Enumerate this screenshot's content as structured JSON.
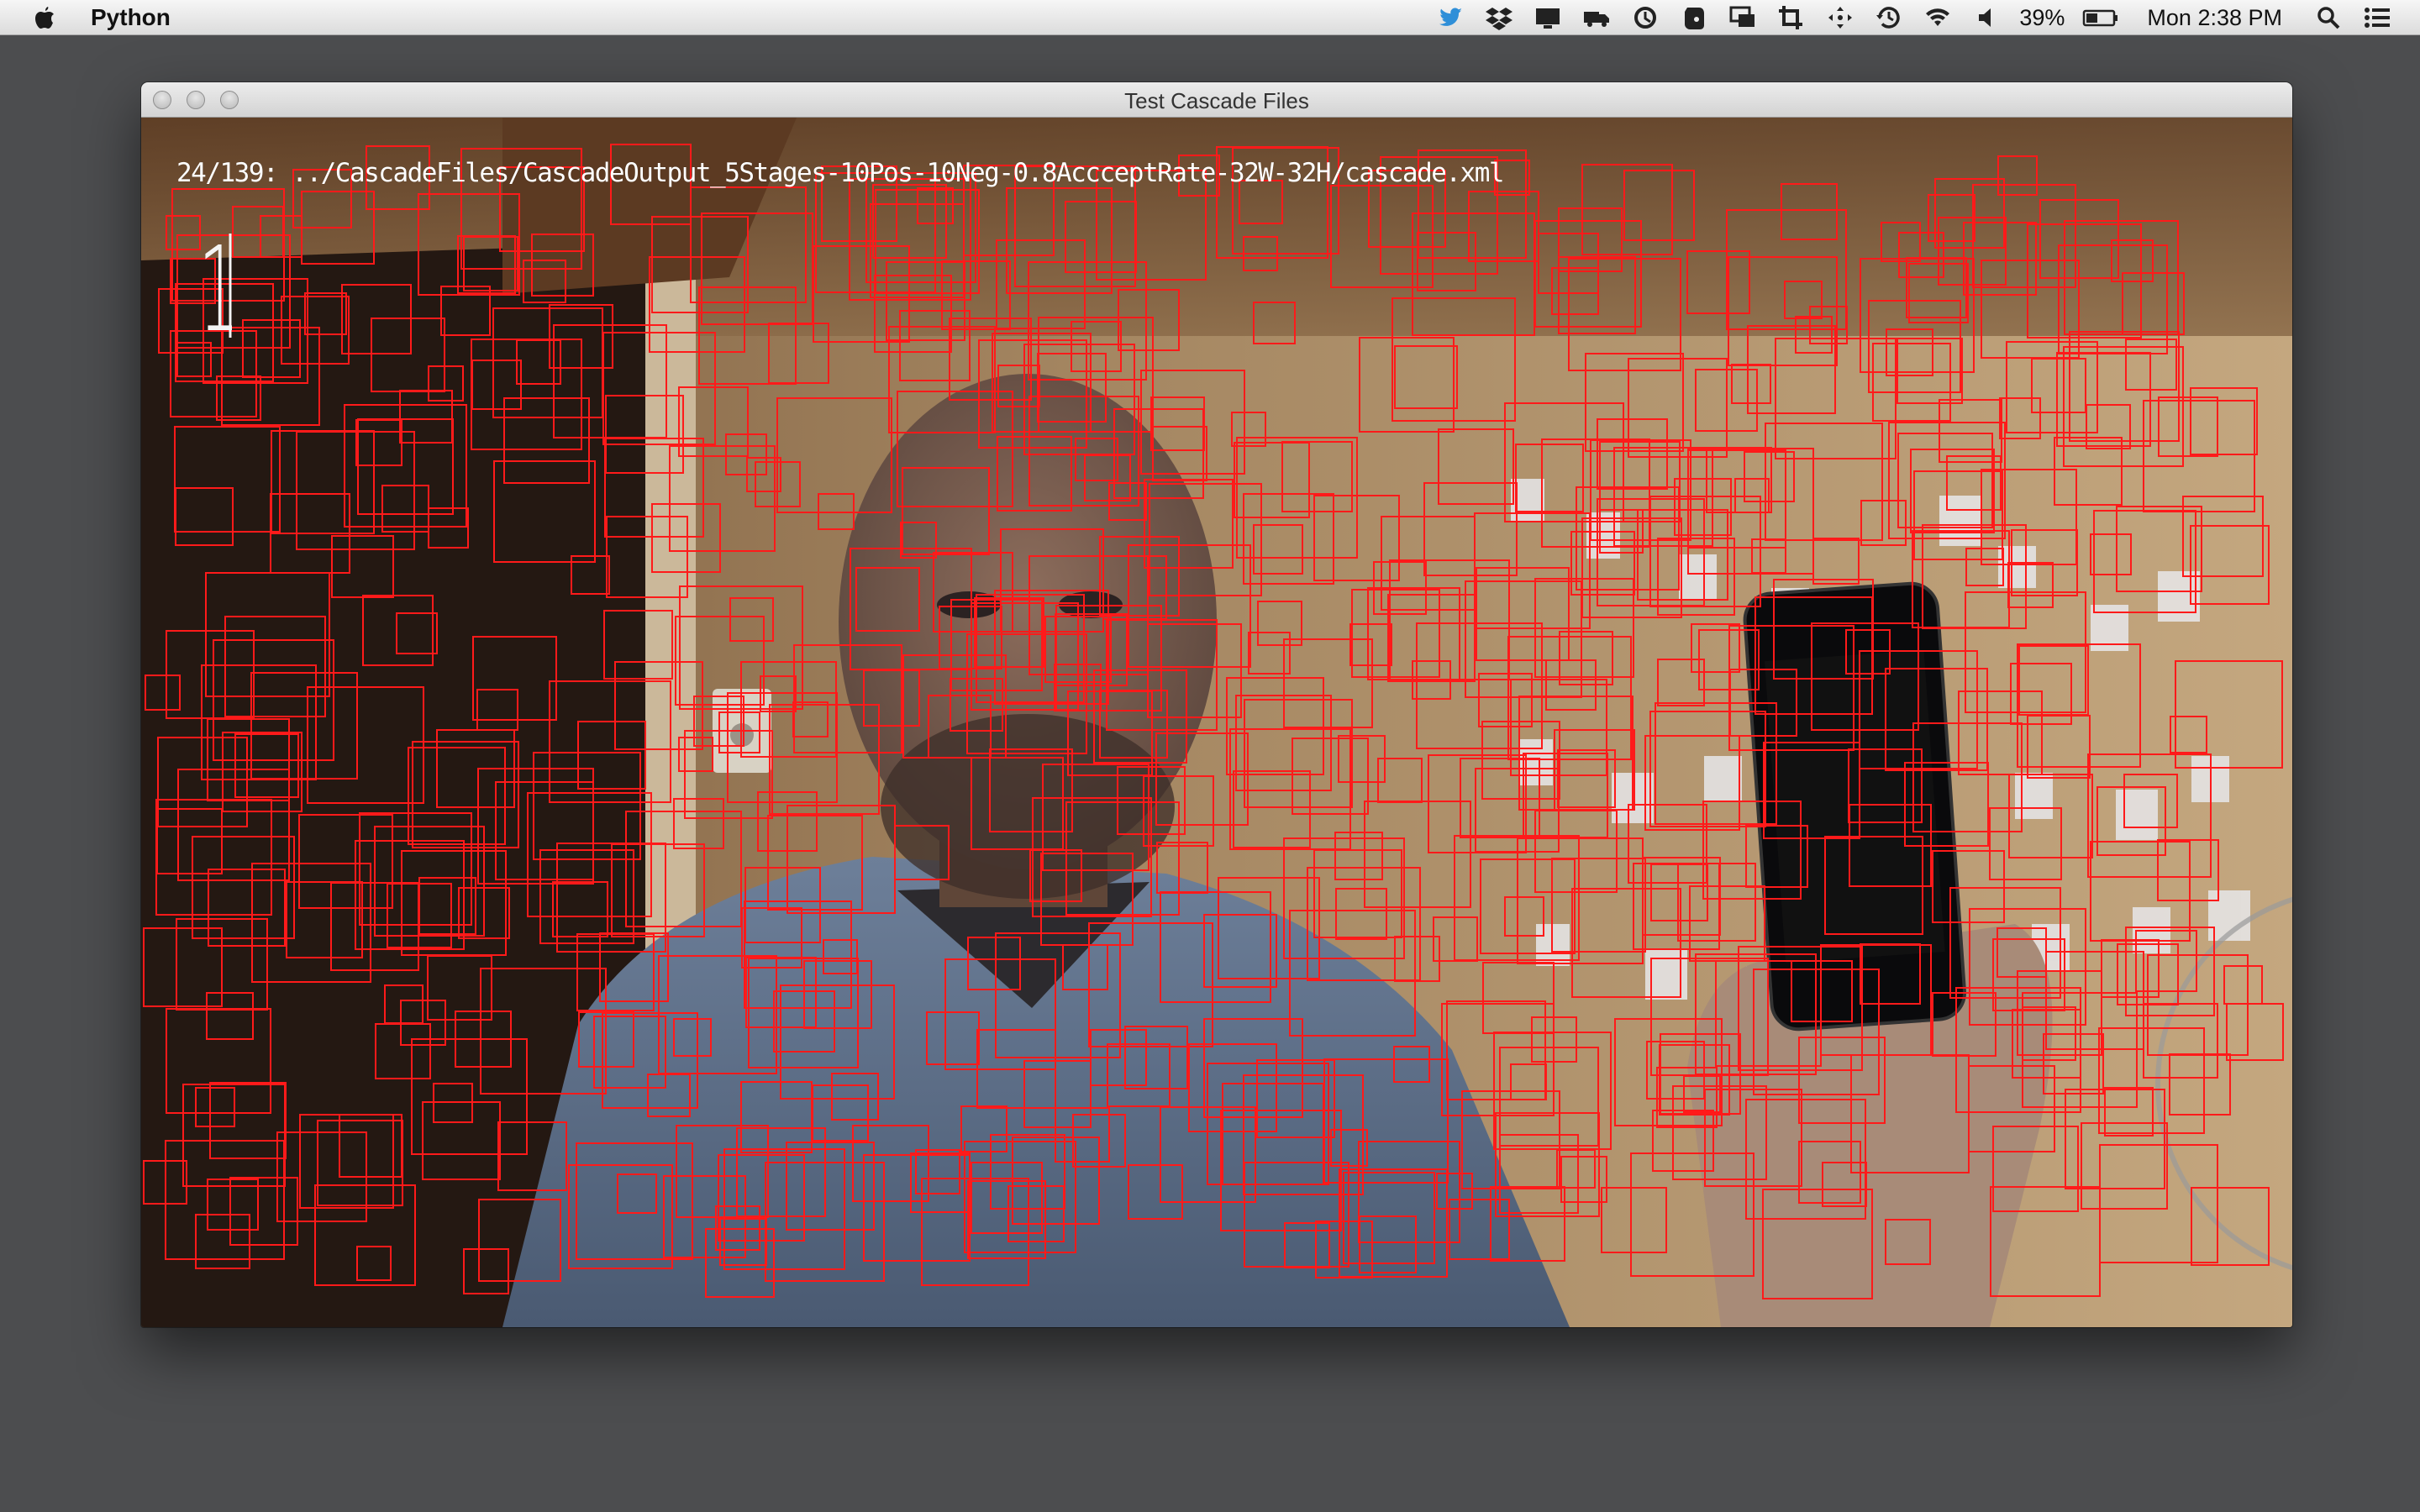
{
  "menubar": {
    "app_name": "Python",
    "battery_percent": "39%",
    "clock": "Mon 2:38 PM",
    "status_icons": [
      "twitter-icon",
      "dropbox-icon",
      "display-icon",
      "truck-icon",
      "sync-icon",
      "evernote-icon",
      "screen-share-icon",
      "crop-icon",
      "move-icon",
      "time-machine-icon",
      "wifi-icon",
      "volume-icon",
      "battery-icon",
      "spotlight-icon",
      "notification-center-icon"
    ]
  },
  "window": {
    "title": "Test Cascade Files"
  },
  "overlay": {
    "cascade_label": "24/139: ../CascadeFiles/CascadeOutput_5Stages-10Pos-10Neg-0.8AccceptRate-32W-32H/cascade.xml",
    "detection_count": "1"
  },
  "colors": {
    "detection_box": "#ff1a1a",
    "desktop": "#4c4d4f"
  }
}
